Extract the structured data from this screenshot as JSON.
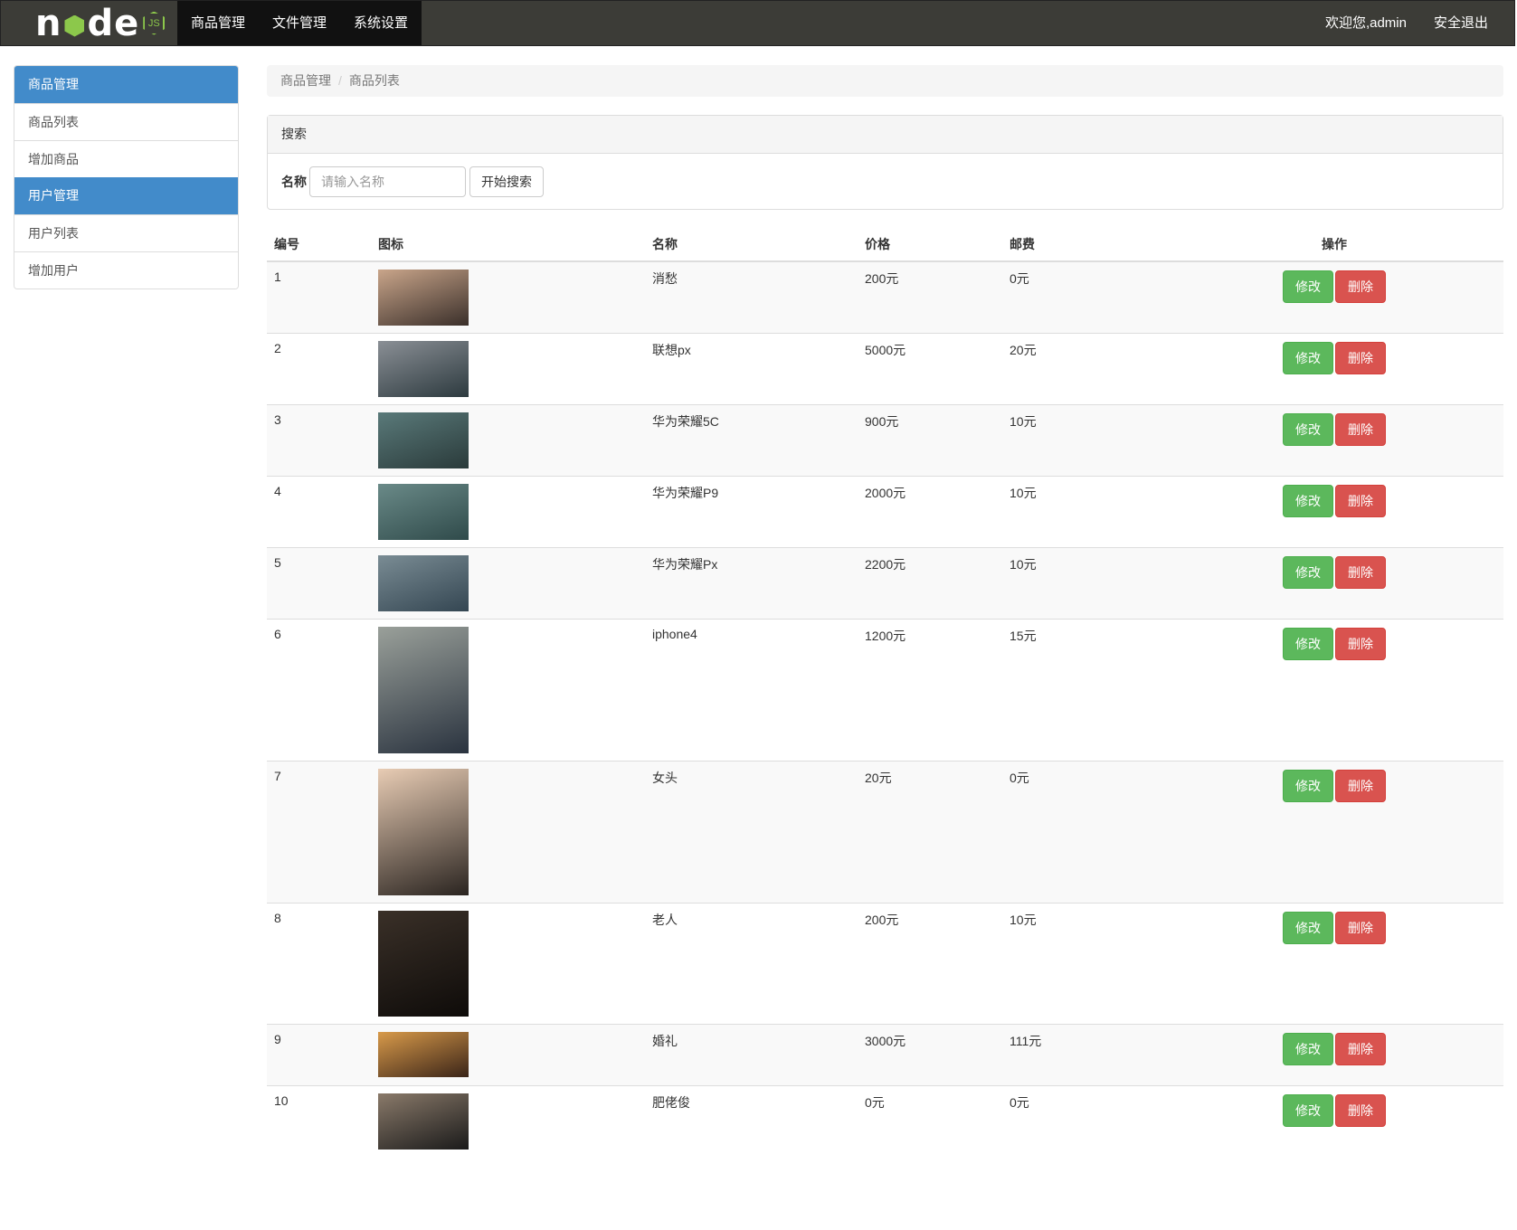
{
  "navbar": {
    "logo_text": "node",
    "logo_badge": "JS",
    "menu": [
      "商品管理",
      "文件管理",
      "系统设置"
    ],
    "welcome": "欢迎您,admin",
    "logout": "安全退出"
  },
  "sidebar": {
    "groups": [
      {
        "title": "商品管理",
        "items": [
          "商品列表",
          "增加商品"
        ]
      },
      {
        "title": "用户管理",
        "items": [
          "用户列表",
          "增加用户"
        ]
      }
    ]
  },
  "breadcrumb": [
    "商品管理",
    "商品列表"
  ],
  "search": {
    "panel_title": "搜索",
    "field_label": "名称",
    "placeholder": "请输入名称",
    "button": "开始搜索"
  },
  "table": {
    "headers": [
      "编号",
      "图标",
      "名称",
      "价格",
      "邮费",
      "操作"
    ],
    "edit_label": "修改",
    "delete_label": "删除",
    "rows": [
      {
        "id": "1",
        "name": "消愁",
        "price": "200元",
        "postage": "0元",
        "img_colors": [
          "#c9a58a",
          "#3a2f2a"
        ]
      },
      {
        "id": "2",
        "name": "联想px",
        "price": "5000元",
        "postage": "20元",
        "img_colors": [
          "#8a8f95",
          "#2d3a3f"
        ]
      },
      {
        "id": "3",
        "name": "华为荣耀5C",
        "price": "900元",
        "postage": "10元",
        "img_colors": [
          "#5a7a7a",
          "#2a3a3a"
        ]
      },
      {
        "id": "4",
        "name": "华为荣耀P9",
        "price": "2000元",
        "postage": "10元",
        "img_colors": [
          "#6a8a88",
          "#2f4a4a"
        ]
      },
      {
        "id": "5",
        "name": "华为荣耀Px",
        "price": "2200元",
        "postage": "10元",
        "img_colors": [
          "#7a8c94",
          "#344652"
        ]
      },
      {
        "id": "6",
        "name": "iphone4",
        "price": "1200元",
        "postage": "15元",
        "img_colors": [
          "#9aa09a",
          "#2a333f"
        ]
      },
      {
        "id": "7",
        "name": "女头",
        "price": "20元",
        "postage": "0元",
        "img_colors": [
          "#e8ccb4",
          "#2a2420"
        ]
      },
      {
        "id": "8",
        "name": "老人",
        "price": "200元",
        "postage": "10元",
        "img_colors": [
          "#3a3028",
          "#0e0b09"
        ]
      },
      {
        "id": "9",
        "name": "婚礼",
        "price": "3000元",
        "postage": "111元",
        "img_colors": [
          "#d89a4a",
          "#3a2418"
        ]
      },
      {
        "id": "10",
        "name": "肥佬俊",
        "price": "0元",
        "postage": "0元",
        "img_colors": [
          "#8a7a6a",
          "#1a1a1a"
        ]
      }
    ]
  }
}
